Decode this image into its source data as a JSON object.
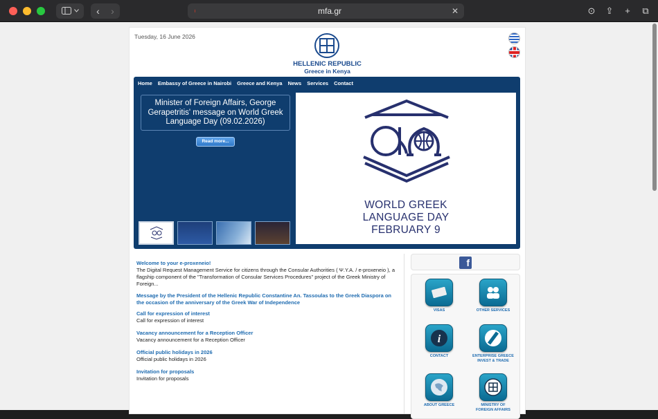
{
  "browser": {
    "url": "mfa.gr",
    "url_left_icon": "reader-icon",
    "buttons": [
      "download-icon",
      "share-icon",
      "new-tab-icon",
      "tabs-overview-icon"
    ]
  },
  "header": {
    "date": "Tuesday, 16 June 2026",
    "title": "HELLENIC REPUBLIC",
    "subtitle": "Greece in Kenya"
  },
  "menu": [
    "Home",
    "Embassy of Greece in Nairobi",
    "Greece and Kenya",
    "News",
    "Services",
    "Contact"
  ],
  "slider": {
    "headline": "Minister of Foreign Affairs, George Gerapetritis' message on World Greek Language Day (09.02.2026)",
    "read_more": "Read more...",
    "feature_line1": "WORLD GREEK",
    "feature_line2": "LANGUAGE DAY",
    "feature_line3": "FEBRUARY 9",
    "colors": {
      "banner": "#0f3d6e",
      "feature_ink": "#27306e"
    }
  },
  "news": [
    {
      "title": "Welcome to your e-proxeneio!",
      "body": "The Digital Request Management Service for citizens through the Consular Authorities ( Ψ.Υ.Α. / e-proxeneio ), a flagship component of the \"Transformation of Consular Services Procedures\" project of the Greek Ministry of Foreign..."
    },
    {
      "title": "Message by the President of the Hellenic Republic Constantine An. Tassoulas to the Greek Diaspora on the occasion of the anniversary of the Greek War of Independence",
      "body": ""
    },
    {
      "title": "Call for expression of interest",
      "body": "Call for expression of interest"
    },
    {
      "title": "Vacancy announcement for a Reception Officer",
      "body": "Vacancy announcement for a Reception Officer"
    },
    {
      "title": "Official public holidays in 2026",
      "body": "Official public holidays in 2026"
    },
    {
      "title": "Invitation for proposals",
      "body": "Invitation for proposals"
    }
  ],
  "services": [
    {
      "label": "VISAS",
      "icon": "passport-icon"
    },
    {
      "label": "OTHER SERVICES",
      "icon": "people-icon"
    },
    {
      "label": "CONTACT",
      "icon": "info-icon"
    },
    {
      "label": "ENTERPRISE GREECE INVEST & TRADE",
      "icon": "enterprise-greece-icon"
    },
    {
      "label": "ABOUT GREECE",
      "icon": "map-icon"
    },
    {
      "label": "MINISTRY OF FOREIGN AFFAIRS",
      "icon": "emblem-icon"
    }
  ],
  "facebook": {
    "glyph": "f"
  }
}
